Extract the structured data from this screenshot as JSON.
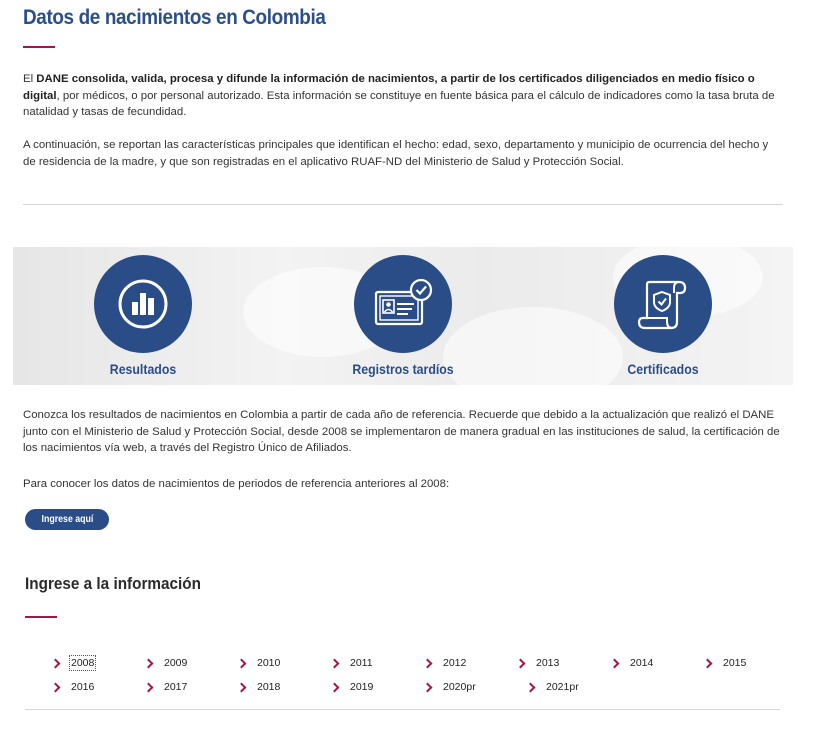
{
  "page": {
    "title": "Datos de nacimientos en Colombia"
  },
  "intro": {
    "p1_prefix": "El ",
    "p1_bold": "DANE consolida, valida, procesa y difunde la información de nacimientos, a partir de los certificados diligenciados en medio físico o digital",
    "p1_suffix": ", por médicos, o por personal autorizado. Esta información se constituye en fuente básica para el cálculo de indicadores como la tasa bruta de natalidad y tasas de fecundidad.",
    "p2": "A continuación, se reportan las características principales que identifican el hecho: edad, sexo, departamento y municipio de ocurrencia del hecho y de residencia de la madre, y que son registradas en el aplicativo RUAF-ND del Ministerio de Salud y Protección Social."
  },
  "categories": [
    {
      "label": "Resultados",
      "icon": "bar-chart-icon"
    },
    {
      "label": "Registros tardíos",
      "icon": "id-card-check-icon"
    },
    {
      "label": "Certificados",
      "icon": "certificate-scroll-icon"
    }
  ],
  "results_text": {
    "p1": "Conozca los resultados de nacimientos en Colombia a partir de cada año de referencia. Recuerde que debido a la actualización que realizó el DANE junto con el Ministerio de Salud y Protección Social, desde 2008 se implementaron de manera gradual en las instituciones de salud, la certificación de los nacimientos vía web, a través del Registro Único de Afiliados.",
    "p2": "Para conocer los datos de nacimientos de periodos de referencia anteriores al 2008:"
  },
  "button": {
    "label": "Ingrese aquí"
  },
  "info": {
    "heading": "Ingrese a la información",
    "years": [
      "2008",
      "2009",
      "2010",
      "2011",
      "2012",
      "2013",
      "2014",
      "2015",
      "2016",
      "2017",
      "2018",
      "2019",
      "2020pr",
      "2021pr"
    ]
  },
  "colors": {
    "primary": "#2a4d88",
    "accent": "#a3164a"
  }
}
